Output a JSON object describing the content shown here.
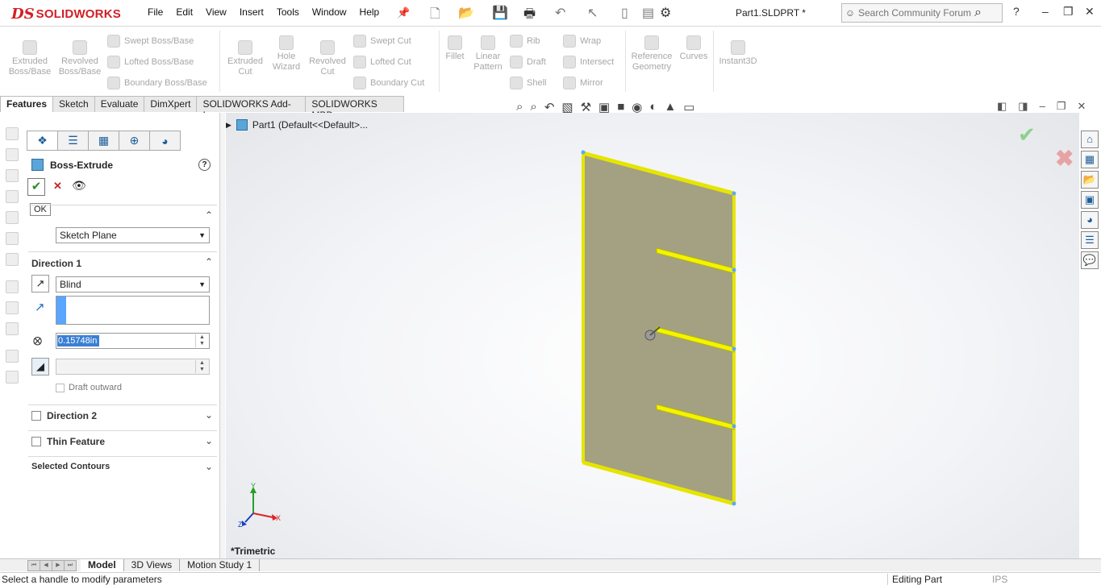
{
  "app": {
    "logo_ds": "DS",
    "logo_name": "SOLIDWORKS",
    "document_title": "Part1.SLDPRT *"
  },
  "menu": [
    "File",
    "Edit",
    "View",
    "Insert",
    "Tools",
    "Window",
    "Help"
  ],
  "search": {
    "placeholder": "Search Community Forum"
  },
  "commands": {
    "extruded_boss": "Extruded Boss/Base",
    "revolved_boss": "Revolved Boss/Base",
    "swept_boss": "Swept Boss/Base",
    "lofted_boss": "Lofted Boss/Base",
    "boundary_boss": "Boundary Boss/Base",
    "extruded_cut": "Extruded Cut",
    "hole_wizard": "Hole Wizard",
    "revolved_cut": "Revolved Cut",
    "swept_cut": "Swept Cut",
    "lofted_cut": "Lofted Cut",
    "boundary_cut": "Boundary Cut",
    "fillet": "Fillet",
    "linear_pattern": "Linear Pattern",
    "rib": "Rib",
    "draft": "Draft",
    "shell": "Shell",
    "wrap": "Wrap",
    "intersect": "Intersect",
    "mirror": "Mirror",
    "reference_geometry": "Reference Geometry",
    "curves": "Curves",
    "instant3d": "Instant3D"
  },
  "tabs": [
    "Features",
    "Sketch",
    "Evaluate",
    "DimXpert",
    "SOLIDWORKS Add-Ins",
    "SOLIDWORKS MBD"
  ],
  "property_manager": {
    "title": "Boss-Extrude",
    "ok_tooltip": "OK",
    "from_value": "Sketch Plane",
    "direction1_label": "Direction 1",
    "end_condition": "Blind",
    "depth_value": "0.15748in",
    "draft_outward_label": "Draft outward",
    "direction2_label": "Direction 2",
    "thin_feature_label": "Thin Feature",
    "selected_contours_label": "Selected Contours"
  },
  "tree": {
    "part_label": "Part1  (Default<<Default>..."
  },
  "viewport": {
    "view_name": "*Trimetric"
  },
  "bottom_tabs": [
    "Model",
    "3D Views",
    "Motion Study 1"
  ],
  "status": {
    "message": "Select a handle to modify parameters",
    "mode": "Editing Part",
    "units": "IPS"
  },
  "colors": {
    "brand": "#d21f26",
    "selection": "#f4f400",
    "plate": "#a3a182",
    "ok_green": "#2e8b2e",
    "cancel_red": "#c62828"
  }
}
